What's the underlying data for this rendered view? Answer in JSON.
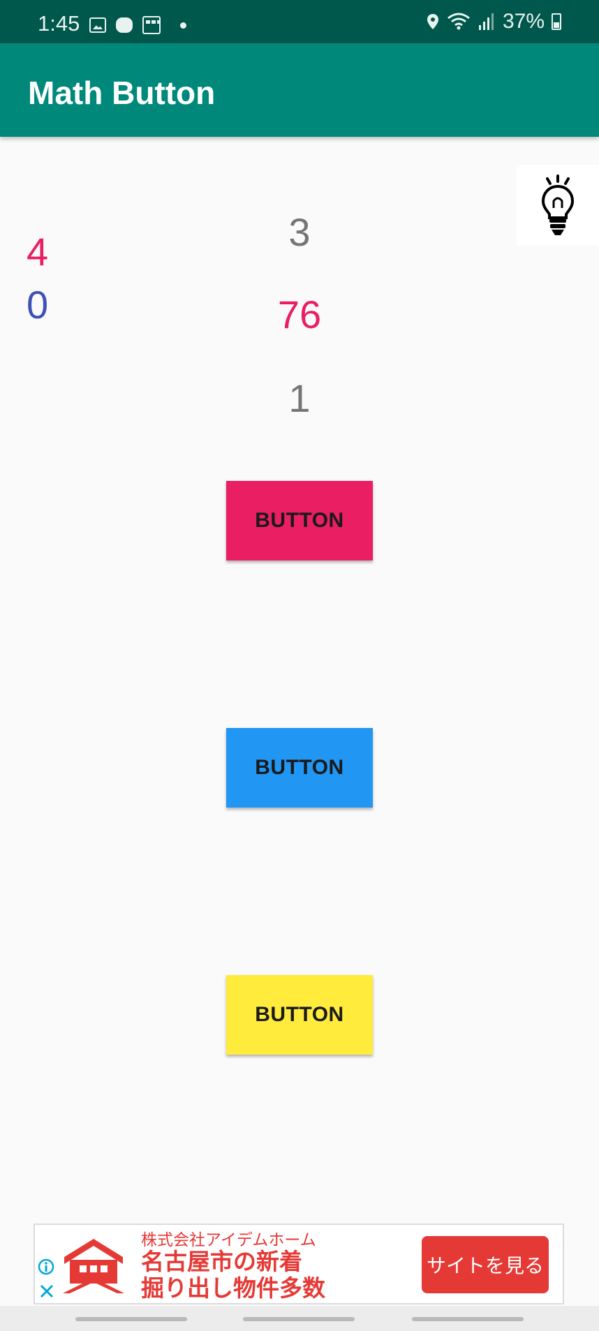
{
  "status_bar": {
    "time": "1:45",
    "battery": "37%",
    "icons": [
      "gallery-icon",
      "game-icon",
      "calendar-icon",
      "dot-icon",
      "location-icon",
      "wifi-icon",
      "signal-icon",
      "battery-icon"
    ]
  },
  "app_bar": {
    "title": "Math Button",
    "color": "#00897b"
  },
  "hint": {
    "icon": "lightbulb-icon"
  },
  "numbers": {
    "left_top": "4",
    "left_bottom": "0",
    "center_top": "3",
    "center_middle": "76",
    "center_bottom": "1"
  },
  "buttons": [
    {
      "label": "BUTTON",
      "color": "#e91e63"
    },
    {
      "label": "BUTTON",
      "color": "#2196f3"
    },
    {
      "label": "BUTTON",
      "color": "#ffeb3b"
    }
  ],
  "ad": {
    "company": "株式会社アイデムホーム",
    "headline_line1": "名古屋市の新着",
    "headline_line2": "掘り出し物件多数",
    "cta": "サイトを見る",
    "accent": "#e53935"
  }
}
